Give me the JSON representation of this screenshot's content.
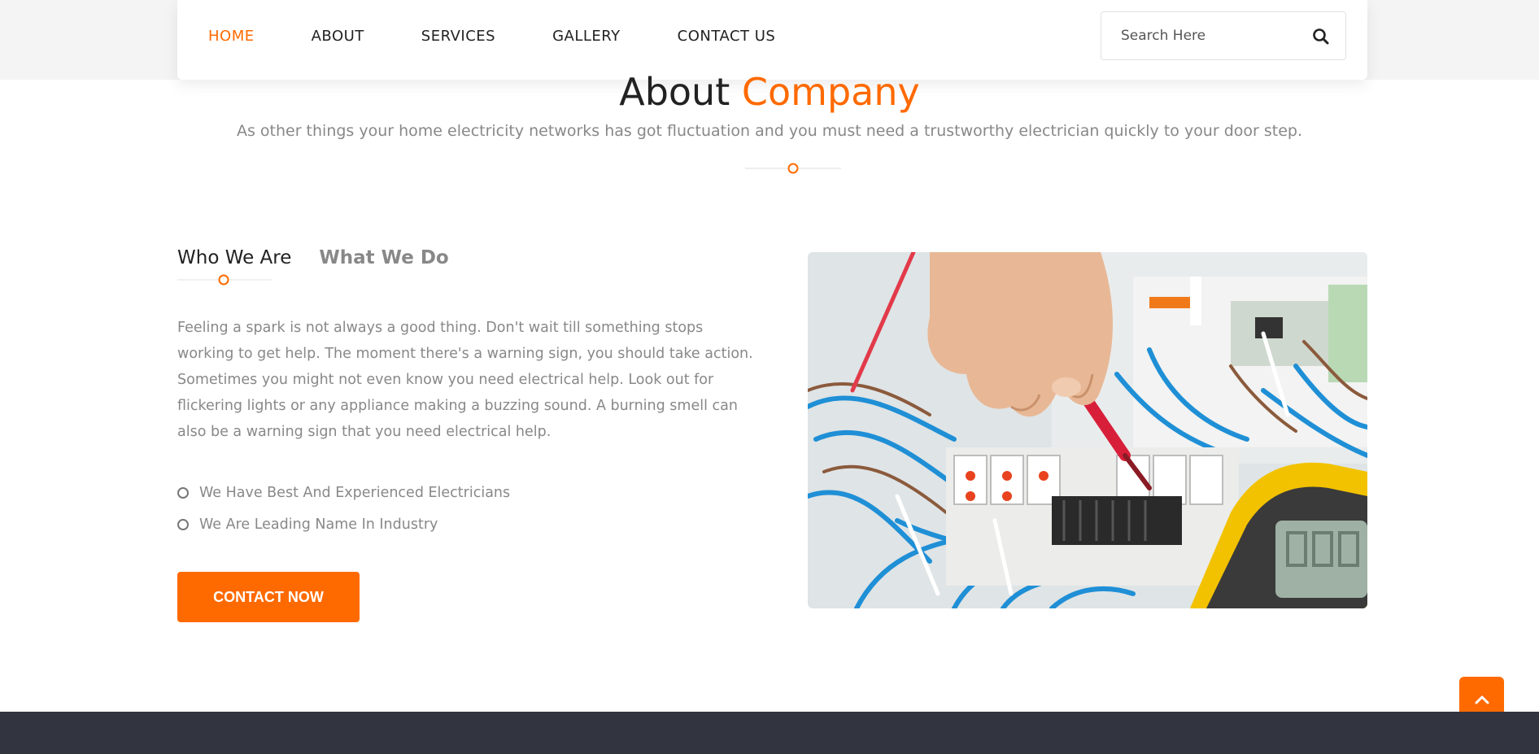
{
  "nav": {
    "items": [
      {
        "label": "HOME",
        "active": true
      },
      {
        "label": "ABOUT",
        "active": false
      },
      {
        "label": "SERVICES",
        "active": false
      },
      {
        "label": "GALLERY",
        "active": false
      },
      {
        "label": "CONTACT US",
        "active": false
      }
    ],
    "search": {
      "placeholder": "Search Here",
      "value": ""
    }
  },
  "section": {
    "title_main": "About",
    "title_accent": "Company",
    "subtitle": "As other things your home electricity networks has got fluctuation and you must need a trustworthy electrician quickly to your door step."
  },
  "tabs": [
    {
      "label": "Who We Are",
      "active": true
    },
    {
      "label": "What We Do",
      "active": false
    }
  ],
  "content": {
    "paragraph": "Feeling a spark is not always a good thing. Don't wait till something stops working to get help. The moment there's a warning sign, you should take action. Sometimes you might not even know you need electrical help. Look out for flickering lights or any appliance making a buzzing sound. A burning smell can also be a warning sign that you need electrical help.",
    "features": [
      "We Have Best And Experienced Electricians",
      "We Are Leading Name In Industry"
    ],
    "cta_label": "CONTACT NOW"
  },
  "colors": {
    "accent": "#ff6a00",
    "text_dark": "#222222",
    "text_muted": "#888888",
    "footer": "#32343f"
  },
  "icons": {
    "search": "search-icon",
    "back_to_top": "chevron-up-icon",
    "divider": "circle-divider-icon",
    "bullet": "circle-bullet-icon"
  }
}
